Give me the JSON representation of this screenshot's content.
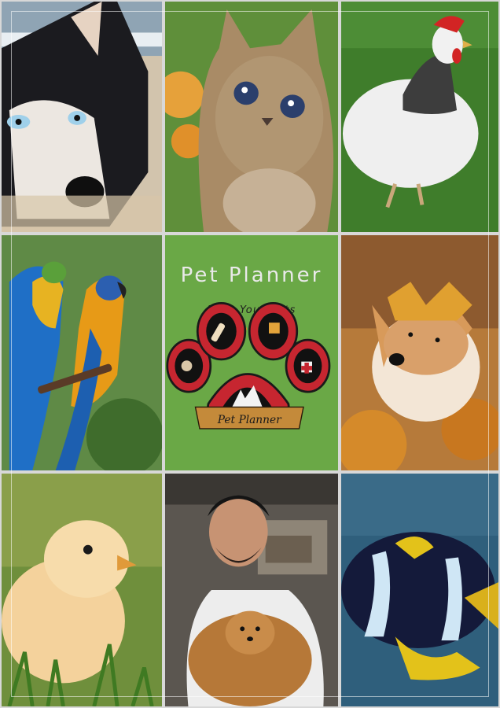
{
  "title": "Pet Planner",
  "tagline": "Love Your Pets",
  "logo": {
    "banner_text": "Pet Planner"
  },
  "tiles": [
    {
      "name": "husky-photo",
      "subject": "husky dog"
    },
    {
      "name": "kitten-photo",
      "subject": "kitten"
    },
    {
      "name": "hen-photo",
      "subject": "white hen"
    },
    {
      "name": "macaws-photo",
      "subject": "macaw parrots"
    },
    {
      "name": "akita-photo",
      "subject": "akita dog in autumn leaves"
    },
    {
      "name": "chick-photo",
      "subject": "baby chick"
    },
    {
      "name": "man-with-pomeranian-photo",
      "subject": "man holding pomeranian"
    },
    {
      "name": "clownfish-photo",
      "subject": "clownfish"
    }
  ],
  "colors": {
    "center_bg": "#6aa846",
    "accent": "#e3782c",
    "logo_red": "#c62630"
  }
}
